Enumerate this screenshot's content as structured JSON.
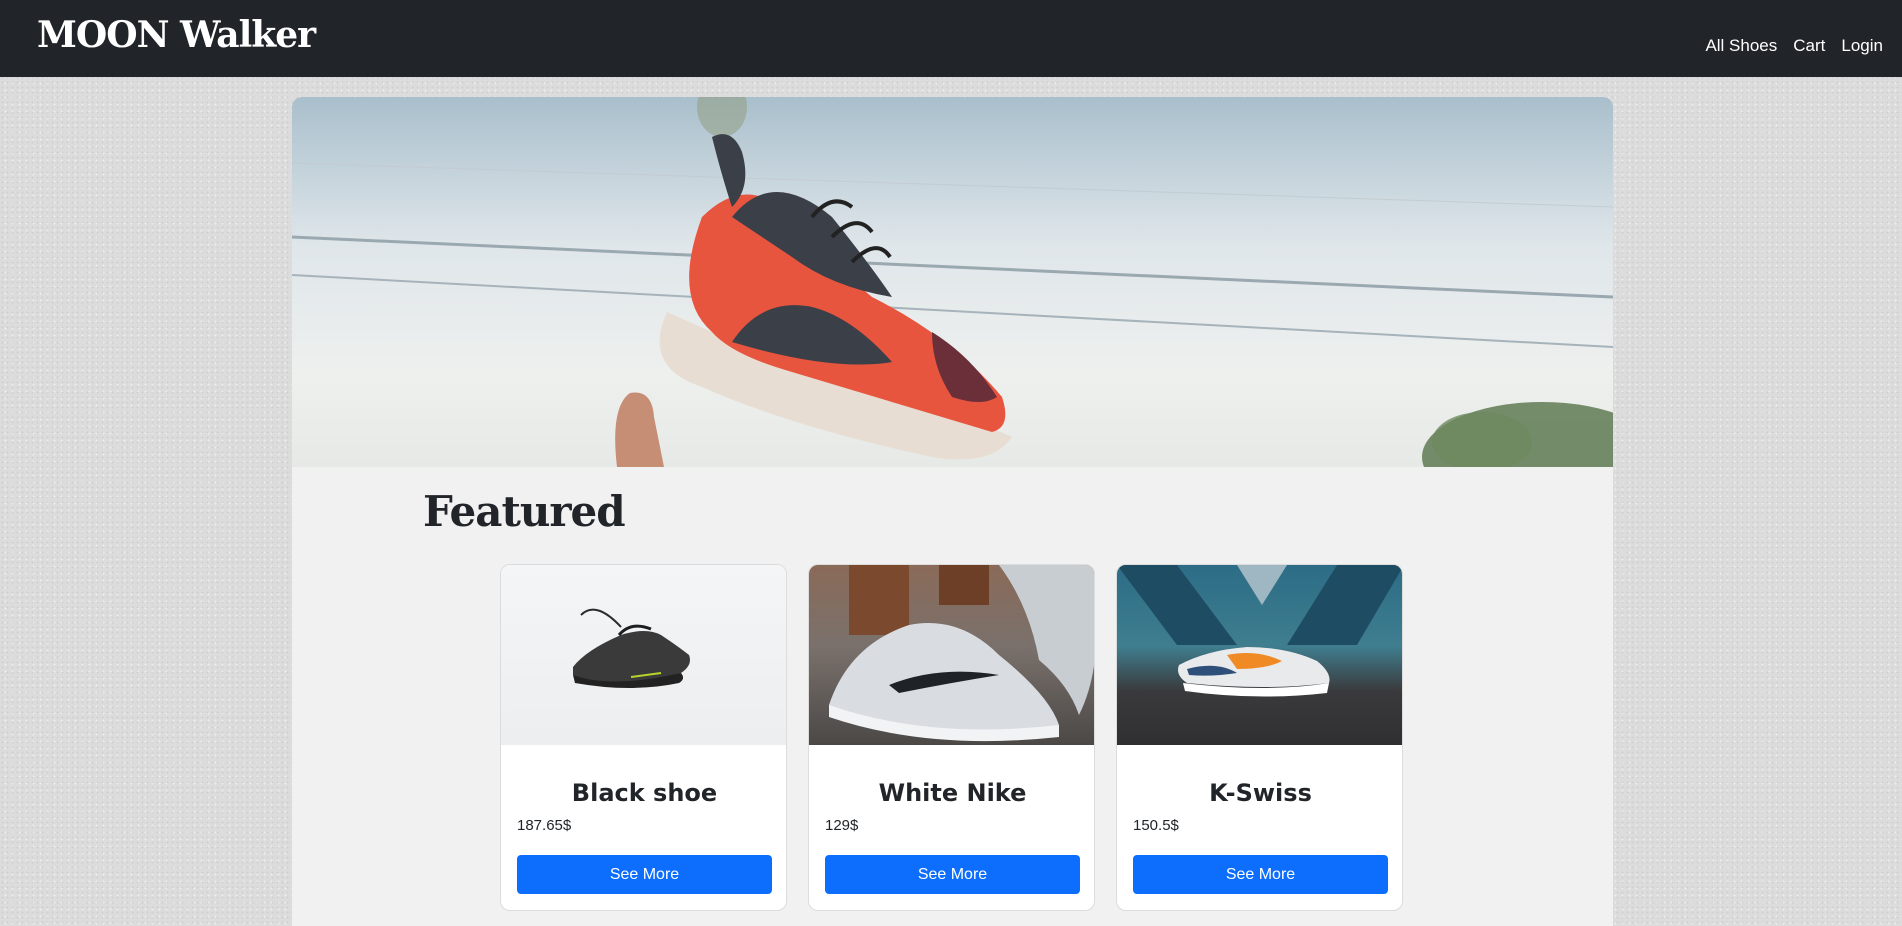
{
  "navbar": {
    "brand": "MOON Walker",
    "links": [
      "All Shoes",
      "Cart",
      "Login"
    ]
  },
  "featured": {
    "title": "Featured",
    "cards": [
      {
        "title": "Black shoe",
        "price": "187.65$",
        "button": "See More"
      },
      {
        "title": "White Nike",
        "price": "129$",
        "button": "See More"
      },
      {
        "title": "K-Swiss",
        "price": "150.5$",
        "button": "See More"
      }
    ]
  },
  "colors": {
    "navbar_bg": "#212529",
    "button_primary": "#0d6efd",
    "content_bg": "#f1f1f1"
  }
}
